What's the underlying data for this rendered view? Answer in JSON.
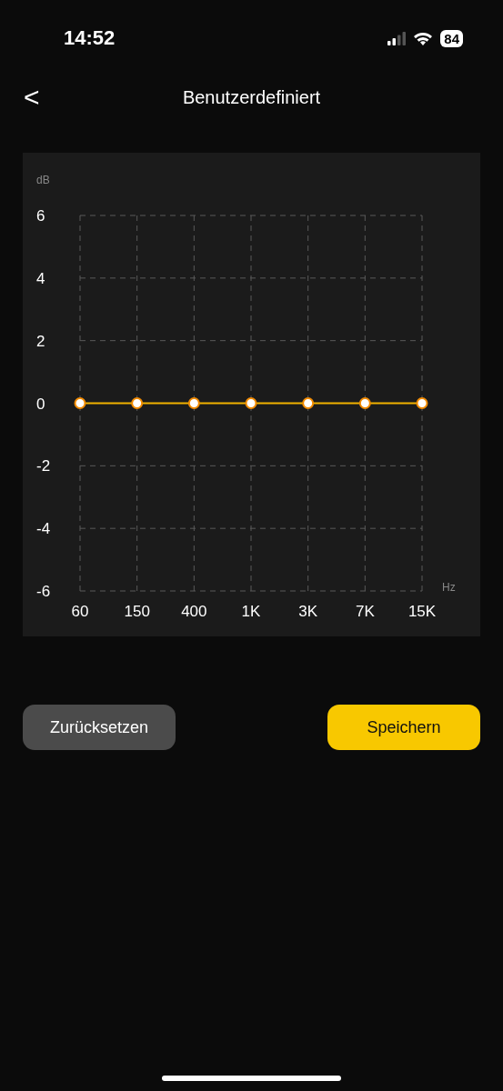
{
  "status_bar": {
    "time": "14:52",
    "battery": "84"
  },
  "nav": {
    "back": "<",
    "title": "Benutzerdefiniert"
  },
  "equalizer": {
    "chart_data": {
      "type": "line",
      "xlabel": "Hz",
      "ylabel": "dB",
      "categories": [
        "60",
        "150",
        "400",
        "1K",
        "3K",
        "7K",
        "15K"
      ],
      "series": [
        {
          "color": "#f2b300",
          "marker": true,
          "values": [
            0,
            0,
            0,
            0,
            0,
            0,
            0
          ]
        }
      ],
      "grid": true,
      "ylim": [
        -6,
        6
      ],
      "yticks": [
        6,
        4,
        2,
        0,
        -2,
        -4,
        -6
      ]
    }
  },
  "buttons": [
    {
      "label": "Zurücksetzen",
      "kind": "secondary"
    },
    {
      "label": "Speichern",
      "kind": "primary"
    }
  ]
}
